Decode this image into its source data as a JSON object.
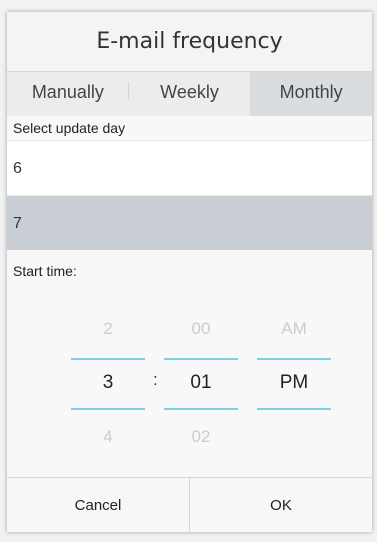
{
  "dialog": {
    "title": "E-mail frequency",
    "tabs": [
      {
        "label": "Manually",
        "active": false
      },
      {
        "label": "Weekly",
        "active": false
      },
      {
        "label": "Monthly",
        "active": true
      }
    ],
    "select_day_label": "Select update day",
    "days": [
      {
        "label": "6",
        "selected": false
      },
      {
        "label": "7",
        "selected": true
      }
    ],
    "start_time_label": "Start time:",
    "time_picker": {
      "hour": {
        "prev": "2",
        "current": "3",
        "next": "4"
      },
      "minute": {
        "prev": "00",
        "current": "01",
        "next": "02"
      },
      "ampm": {
        "prev": "AM",
        "current": "PM"
      },
      "separator": ":"
    },
    "buttons": {
      "cancel": "Cancel",
      "ok": "OK"
    },
    "colors": {
      "accent_line": "#7fcfea",
      "selected_row": "#c8ced3",
      "active_tab": "#d9dde0"
    }
  }
}
